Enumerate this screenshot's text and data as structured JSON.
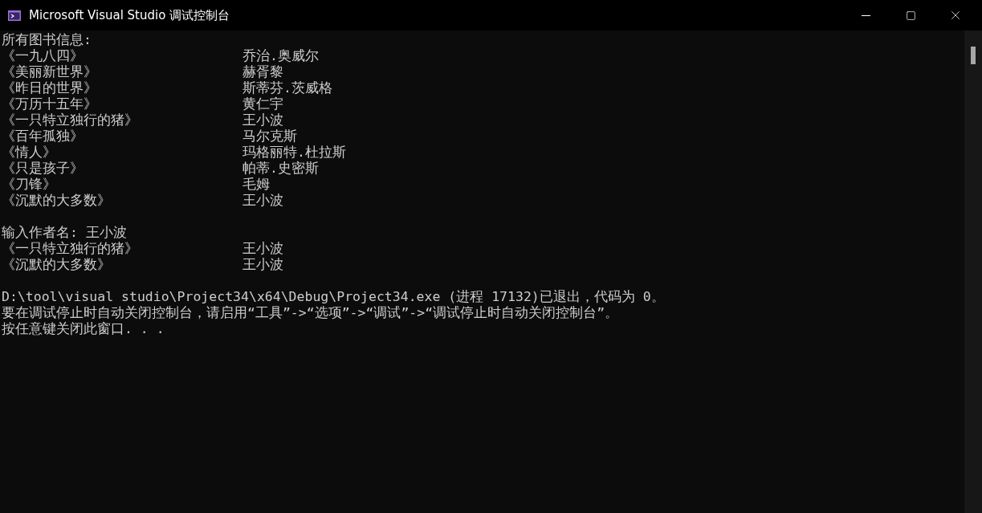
{
  "window": {
    "title": "Microsoft Visual Studio 调试控制台"
  },
  "console": {
    "lines": [
      {
        "kind": "text",
        "text": "所有图书信息:"
      },
      {
        "kind": "row",
        "title": "《一九八四》",
        "author": "乔治.奥威尔"
      },
      {
        "kind": "row",
        "title": "《美丽新世界》",
        "author": "赫胥黎"
      },
      {
        "kind": "row",
        "title": "《昨日的世界》",
        "author": "斯蒂芬.茨威格"
      },
      {
        "kind": "row",
        "title": "《万历十五年》",
        "author": "黄仁宇"
      },
      {
        "kind": "row",
        "title": "《一只特立独行的猪》",
        "author": "王小波"
      },
      {
        "kind": "row",
        "title": "《百年孤独》",
        "author": "马尔克斯"
      },
      {
        "kind": "row",
        "title": "《情人》",
        "author": "玛格丽特.杜拉斯"
      },
      {
        "kind": "row",
        "title": "《只是孩子》",
        "author": "帕蒂.史密斯"
      },
      {
        "kind": "row",
        "title": "《刀锋》",
        "author": "毛姆"
      },
      {
        "kind": "row",
        "title": "《沉默的大多数》",
        "author": "王小波"
      },
      {
        "kind": "blank"
      },
      {
        "kind": "text",
        "text": "输入作者名: 王小波"
      },
      {
        "kind": "row",
        "title": "《一只特立独行的猪》",
        "author": "王小波"
      },
      {
        "kind": "row",
        "title": "《沉默的大多数》",
        "author": "王小波"
      },
      {
        "kind": "blank"
      },
      {
        "kind": "text",
        "text": "D:\\tool\\visual studio\\Project34\\x64\\Debug\\Project34.exe (进程 17132)已退出，代码为 0。"
      },
      {
        "kind": "text",
        "text": "要在调试停止时自动关闭控制台，请启用“工具”->“选项”->“调试”->“调试停止时自动关闭控制台”。"
      },
      {
        "kind": "text",
        "text": "按任意键关闭此窗口. . ."
      }
    ]
  }
}
